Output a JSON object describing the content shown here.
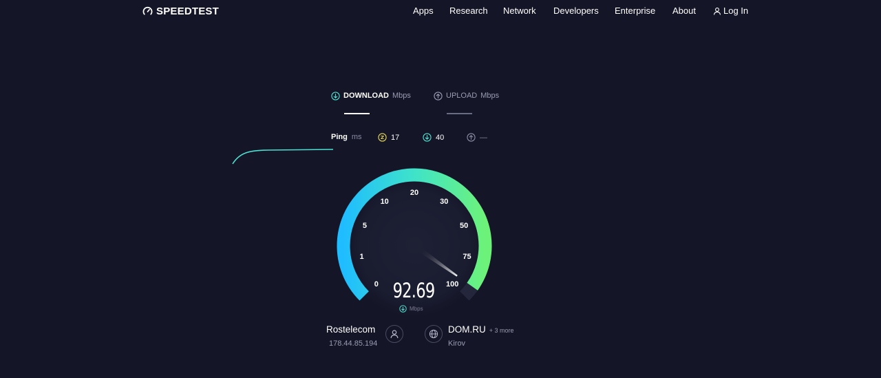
{
  "header": {
    "logo_text": "SPEEDTEST",
    "nav": [
      {
        "label": "Apps"
      },
      {
        "label": "Research"
      },
      {
        "label": "Network"
      },
      {
        "label": "Developers"
      },
      {
        "label": "Enterprise"
      },
      {
        "label": "About"
      }
    ],
    "login_label": "Log In"
  },
  "tabs": {
    "download": {
      "label": "DOWNLOAD",
      "unit": "Mbps",
      "active": true
    },
    "upload": {
      "label": "UPLOAD",
      "unit": "Mbps",
      "active": false
    }
  },
  "ping": {
    "label": "Ping",
    "unit": "ms",
    "idle": "17",
    "download": "40",
    "upload": "—"
  },
  "gauge": {
    "value": 92.69,
    "value_text": "92.69",
    "unit": "Mbps",
    "max": 100,
    "ticks": [
      "0",
      "1",
      "5",
      "10",
      "20",
      "30",
      "50",
      "75",
      "100"
    ]
  },
  "isp": {
    "name": "Rostelecom",
    "ip": "178.44.85.194"
  },
  "server": {
    "name": "DOM.RU",
    "more": "+ 3 more",
    "location": "Kirov"
  },
  "colors": {
    "background": "#141526",
    "accent_cyan": "#1fbdff",
    "accent_green": "#6df279",
    "download_accent": "#4ee0d2",
    "ping_yellow": "#e6d85a"
  }
}
